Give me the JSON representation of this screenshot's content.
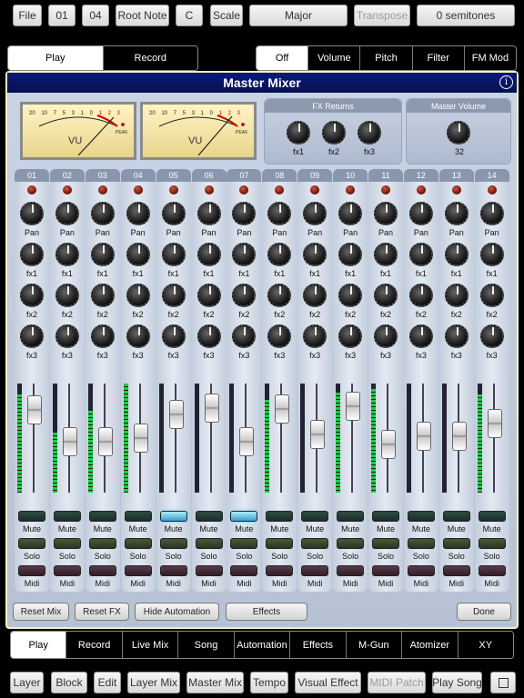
{
  "toolbar": {
    "file": "File",
    "num1": "01",
    "num2": "04",
    "root_note_label": "Root Note",
    "root_note_value": "C",
    "scale_label": "Scale",
    "scale_value": "Major",
    "transpose_label": "Transpose",
    "transpose_value": "0 semitones"
  },
  "mode_tabs": [
    "Play",
    "Record"
  ],
  "view_tabs": [
    "Off",
    "Volume",
    "Pitch",
    "Filter",
    "FM Mod"
  ],
  "mixer": {
    "title": "Master Mixer",
    "info": "i",
    "vu_label": "VU",
    "peak_label": "PEAK",
    "vu_scale": [
      "20",
      "10",
      "7",
      "5",
      "3",
      "1",
      "0",
      "1",
      "2",
      "3"
    ],
    "fx_returns": {
      "title": "FX Returns",
      "knobs": [
        "fx1",
        "fx2",
        "fx3"
      ]
    },
    "master_volume": {
      "title": "Master Volume",
      "value": "32"
    },
    "knob_labels": {
      "pan": "Pan",
      "fx1": "fx1",
      "fx2": "fx2",
      "fx3": "fx3"
    },
    "pad_labels": {
      "mute": "Mute",
      "solo": "Solo",
      "midi": "Midi"
    },
    "channels": [
      {
        "num": "01",
        "fader": 0.85,
        "meter": 0.9,
        "mute": false
      },
      {
        "num": "02",
        "fader": 0.45,
        "meter": 0.55,
        "mute": false
      },
      {
        "num": "03",
        "fader": 0.45,
        "meter": 0.75,
        "mute": false
      },
      {
        "num": "04",
        "fader": 0.5,
        "meter": 1.0,
        "mute": false
      },
      {
        "num": "05",
        "fader": 0.8,
        "meter": 0.0,
        "mute": true
      },
      {
        "num": "06",
        "fader": 0.88,
        "meter": 0.0,
        "mute": false
      },
      {
        "num": "07",
        "fader": 0.45,
        "meter": 0.0,
        "mute": true
      },
      {
        "num": "08",
        "fader": 0.86,
        "meter": 0.85,
        "mute": false
      },
      {
        "num": "09",
        "fader": 0.55,
        "meter": 0.0,
        "mute": false
      },
      {
        "num": "10",
        "fader": 0.9,
        "meter": 0.92,
        "mute": false
      },
      {
        "num": "11",
        "fader": 0.42,
        "meter": 0.95,
        "mute": false
      },
      {
        "num": "12",
        "fader": 0.52,
        "meter": 0.0,
        "mute": false
      },
      {
        "num": "13",
        "fader": 0.52,
        "meter": 0.0,
        "mute": false
      },
      {
        "num": "14",
        "fader": 0.68,
        "meter": 0.9,
        "mute": false
      }
    ],
    "bottom_buttons": {
      "reset_mix": "Reset Mix",
      "reset_fx": "Reset FX",
      "hide_automation": "Hide Automation",
      "effects": "Effects",
      "done": "Done"
    }
  },
  "main_tabs": [
    "Play",
    "Record",
    "Live Mix",
    "Song",
    "Automation",
    "Effects",
    "M-Gun",
    "Atomizer",
    "XY"
  ],
  "footer": [
    "Layer",
    "Block",
    "Edit",
    "Layer Mix",
    "Master Mix",
    "Tempo",
    "Visual Effect",
    "MIDI Patch",
    "Play Song"
  ],
  "colors": {
    "title_bar": "#0a1a7a",
    "panel_border": "#f2f2c0",
    "mute_lit": "#7df",
    "meter_green": "#2c4"
  }
}
